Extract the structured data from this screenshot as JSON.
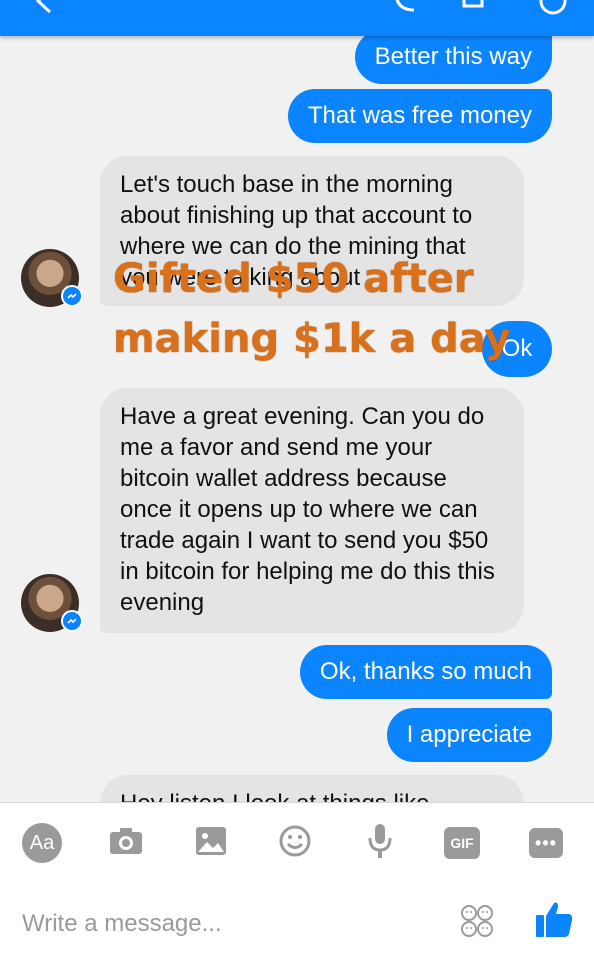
{
  "messages": [
    {
      "text": "Better this way"
    },
    {
      "text": "That was free money"
    },
    {
      "text": "Let's touch base in the morning about finishing up that account to where we can do the mining that you were talking about"
    },
    {
      "text": "Ok"
    },
    {
      "text": "Have a great evening. Can you do me a favor and send me your bitcoin wallet address because once it opens up to where we can trade again I want to send you $50 in bitcoin for helping me do this this evening"
    },
    {
      "text": "Ok, thanks so much"
    },
    {
      "text": "I appreciate"
    },
    {
      "text": "Hey listen I look at things like"
    }
  ],
  "overlay": {
    "line1": "Gifted $50 after",
    "line2": "making $1k a day"
  },
  "composer": {
    "aa_label": "Aa",
    "gif_label": "GIF",
    "more_label": "•••",
    "placeholder": "Write a message..."
  },
  "colors": {
    "accent": "#0a84ff",
    "incoming_bubble": "#e4e4e4",
    "chat_background": "#f1f1f1",
    "overlay_text": "#d9701c",
    "toolbar_icon": "#9a9a9a"
  },
  "icons": [
    "camera-icon",
    "photo-icon",
    "emoji-icon",
    "microphone-icon",
    "sticker-icon",
    "like-icon",
    "messenger-badge-icon"
  ]
}
